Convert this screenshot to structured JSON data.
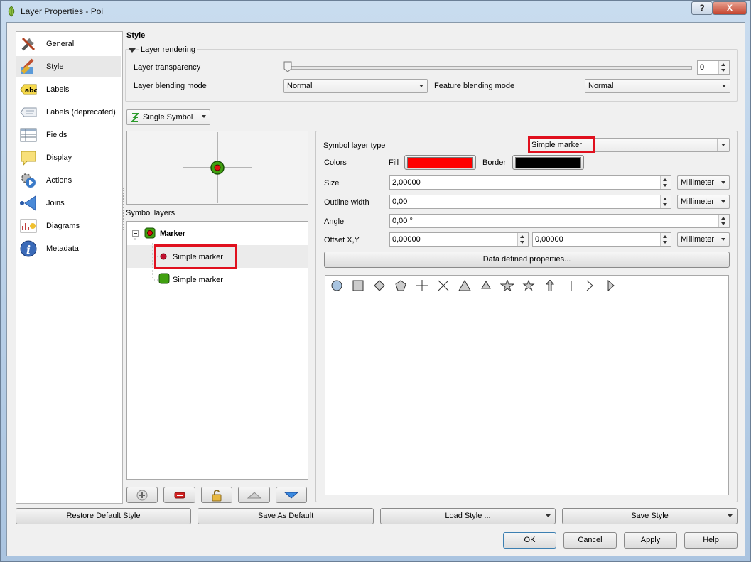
{
  "window": {
    "title": "Layer Properties - Poi",
    "help_label": "?",
    "close_label": "X"
  },
  "nav": {
    "items": [
      {
        "label": "General",
        "icon": "tools-icon"
      },
      {
        "label": "Style",
        "icon": "paintbrush-icon"
      },
      {
        "label": "Labels",
        "icon": "abc-label-icon"
      },
      {
        "label": "Labels (deprecated)",
        "icon": "label-deprecated-icon"
      },
      {
        "label": "Fields",
        "icon": "table-icon"
      },
      {
        "label": "Display",
        "icon": "speech-bubble-icon"
      },
      {
        "label": "Actions",
        "icon": "gear-play-icon"
      },
      {
        "label": "Joins",
        "icon": "join-icon"
      },
      {
        "label": "Diagrams",
        "icon": "diagram-icon"
      },
      {
        "label": "Metadata",
        "icon": "info-icon"
      }
    ],
    "active": "Style"
  },
  "style": {
    "title": "Style",
    "layer_rendering": {
      "title": "Layer rendering",
      "transparency_label": "Layer transparency",
      "transparency_value": "0",
      "transparency_fraction": 0,
      "layer_blending_label": "Layer blending mode",
      "layer_blending_value": "Normal",
      "feature_blending_label": "Feature blending mode",
      "feature_blending_value": "Normal"
    },
    "renderer_value": "Single Symbol",
    "symbol_layers_label": "Symbol layers",
    "tree": {
      "root": "Marker",
      "children": [
        "Simple marker",
        "Simple marker"
      ]
    }
  },
  "symbol_props": {
    "type_label": "Symbol layer type",
    "type_value": "Simple marker",
    "colors_label": "Colors",
    "fill_label": "Fill",
    "fill_color": "#ff0000",
    "border_label": "Border",
    "border_color": "#000000",
    "size_label": "Size",
    "size_value": "2,00000",
    "size_unit": "Millimeter",
    "outline_label": "Outline width",
    "outline_value": "0,00",
    "outline_unit": "Millimeter",
    "angle_label": "Angle",
    "angle_value": "0,00 °",
    "offset_label": "Offset X,Y",
    "offset_x": "0,00000",
    "offset_y": "0,00000",
    "offset_unit": "Millimeter",
    "ddp_label": "Data defined properties...",
    "shapes": [
      "circle",
      "square",
      "diamond",
      "pentagon",
      "cross",
      "x",
      "triangle",
      "equilateral-triangle",
      "star",
      "regular-star",
      "arrow",
      "line",
      "arrowhead",
      "filled-arrowhead"
    ]
  },
  "bottom": {
    "restore": "Restore Default Style",
    "save_default": "Save As Default",
    "load": "Load Style ...",
    "save": "Save Style",
    "ok": "OK",
    "cancel": "Cancel",
    "apply": "Apply",
    "help": "Help"
  }
}
